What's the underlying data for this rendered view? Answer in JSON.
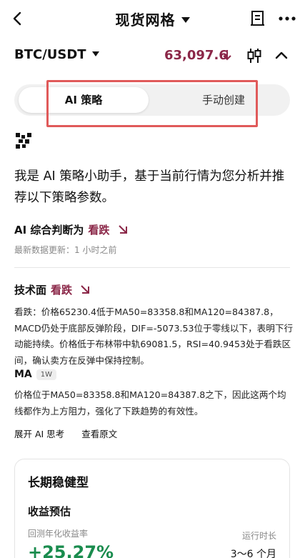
{
  "header": {
    "title": "现货网格"
  },
  "pair": {
    "symbol": "BTC/USDT",
    "price": "63,097.6"
  },
  "segment": {
    "active_label": "AI 策略",
    "other_label": "手动创建"
  },
  "assistant": {
    "intro": "我是 AI 策略小助手，基于当前行情为您分析并推荐以下策略参数。"
  },
  "judgement": {
    "label": "AI 综合判断为",
    "verdict": "看跌",
    "updated": "最新数据更新：1 小时之前"
  },
  "technical": {
    "label": "技术面",
    "verdict": "看跌",
    "text": "看跌：价格65230.4低于MA50=83358.8和MA120=84387.8，MACD仍处于底部反弹阶段，DIF=-5073.53位于零线以下，表明下行动能持续。价格低于布林带中轨69081.5，RSI=40.9453处于看跌区间，确认卖方在反弹中保持控制。"
  },
  "ma": {
    "label": "MA",
    "badge": "1W",
    "text": "价格位于MA50=83358.8和MA120=84387.8之下，因此这两个均线都作为上方阻力，强化了下跌趋势的有效性。"
  },
  "links": {
    "expand": "展开 AI 思考",
    "view_source": "查看原文"
  },
  "card": {
    "title": "长期稳健型",
    "subtitle": "收益预估",
    "return_label": "回测年化收益率",
    "return_value": "+25.27%",
    "duration_label": "运行时长",
    "duration_value": "3～6 个月"
  },
  "colors": {
    "bear": "#8b2748",
    "positive": "#1a8c4e",
    "highlight": "#e05a5a"
  },
  "icons": [
    "back-arrow-icon",
    "caret-down-icon",
    "document-icon",
    "more-icon",
    "down-arrow-icon",
    "candlestick-icon",
    "chevron-up-icon",
    "ai-avatar-icon",
    "down-right-arrow-icon"
  ]
}
